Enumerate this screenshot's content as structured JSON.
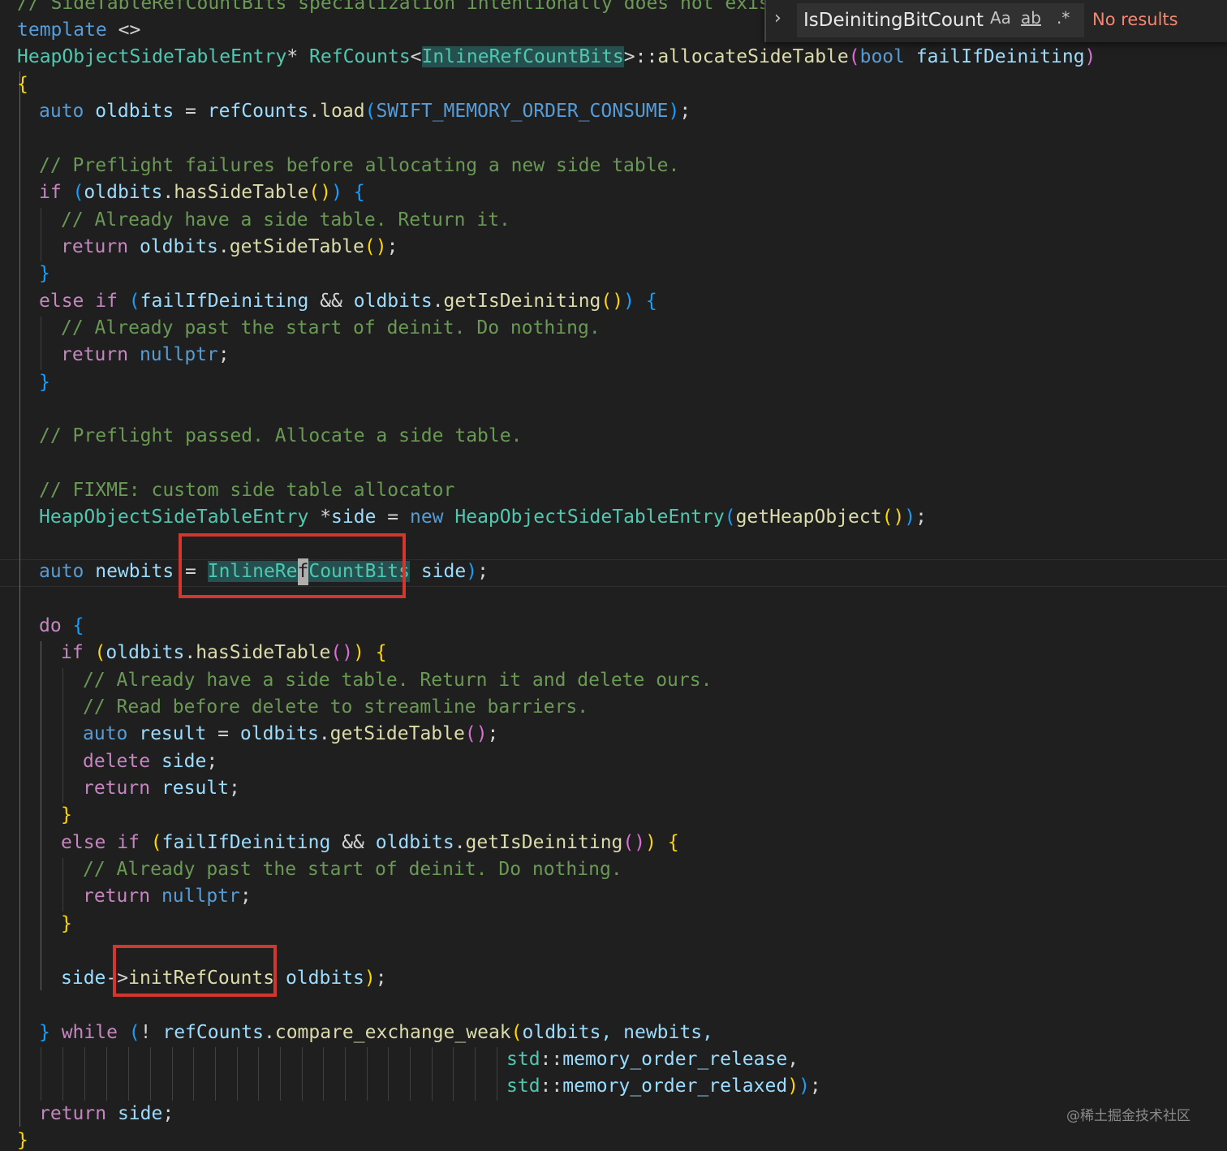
{
  "find_widget": {
    "query": "IsDeinitingBitCount",
    "match_case_label": "Aa",
    "whole_word_label": "ab",
    "regex_label": ".*",
    "status": "No results"
  },
  "code": {
    "l1": {
      "comment": "// SideTableRefCountBits specialization intentionally does not exist."
    },
    "l2": {
      "kw": "template",
      "rest": " <>"
    },
    "l3": {
      "type": "HeapObjectSideTableEntry",
      "star": "* ",
      "cls": "RefCounts",
      "lt": "<",
      "tparam": "InlineRefCountBits",
      "gt": ">::",
      "fn": "allocateSideTable",
      "lp": "(",
      "ptype": "bool",
      "pname": " failIfDeiniting",
      "rp": ")"
    },
    "l4": {
      "brace": "{"
    },
    "l5": {
      "kw": "auto",
      "v": " oldbits",
      "eq": " = ",
      "obj": "refCounts",
      "dot": ".",
      "fn": "load",
      "lp": "(",
      "const": "SWIFT_MEMORY_ORDER_CONSUME",
      "rp": ")",
      "semi": ";"
    },
    "l6": {
      "comment": "// Preflight failures before allocating a new side table."
    },
    "l7": {
      "kw": "if",
      "lp": " (",
      "obj": "oldbits",
      "dot": ".",
      "fn": "hasSideTable",
      "pp": "()",
      "rp": ")",
      "brace": " {"
    },
    "l8": {
      "comment": "// Already have a side table. Return it."
    },
    "l9": {
      "kw": "return",
      "obj": " oldbits",
      "dot": ".",
      "fn": "getSideTable",
      "pp": "()",
      "semi": ";"
    },
    "l10": {
      "brace": "}"
    },
    "l11": {
      "kw": "else if",
      "lp": " (",
      "v": "failIfDeiniting",
      "op": " && ",
      "obj": "oldbits",
      "dot": ".",
      "fn": "getIsDeiniting",
      "pp": "()",
      "rp": ")",
      "brace": " {"
    },
    "l12": {
      "comment": "// Already past the start of deinit. Do nothing."
    },
    "l13": {
      "kw": "return",
      "val": " nullptr",
      "semi": ";"
    },
    "l14": {
      "brace": "}"
    },
    "l15": {
      "comment": "// Preflight passed. Allocate a side table."
    },
    "l16": {
      "comment": "// FIXME: custom side table allocator"
    },
    "l17": {
      "type": "HeapObjectSideTableEntry",
      "op": " *",
      "v": "side",
      "eq": " = ",
      "kw": "new",
      "type2": " HeapObjectSideTableEntry",
      "lp": "(",
      "fn": "getHeapObject",
      "pp": "()",
      "rp": ")",
      "semi": ";"
    },
    "l18": {
      "kw": "auto",
      "v": " newbits",
      "eq": " = ",
      "type_a": "InlineRe",
      "cursor": "f",
      "type_b": "CountBits",
      "rest": " side",
      "rp": ")",
      "semi": ";"
    },
    "l19": {
      "kw": "do",
      "brace": " {"
    },
    "l20": {
      "kw": "if",
      "lp": " (",
      "obj": "oldbits",
      "dot": ".",
      "fn": "hasSideTable",
      "pp": "()",
      "rp": ")",
      "brace": " {"
    },
    "l21": {
      "comment": "// Already have a side table. Return it and delete ours."
    },
    "l22": {
      "comment": "// Read before delete to streamline barriers."
    },
    "l23": {
      "kw": "auto",
      "v": " result",
      "eq": " = ",
      "obj": "oldbits",
      "dot": ".",
      "fn": "getSideTable",
      "pp": "()",
      "semi": ";"
    },
    "l24": {
      "kw": "delete",
      "v": " side",
      "semi": ";"
    },
    "l25": {
      "kw": "return",
      "v": " result",
      "semi": ";"
    },
    "l26": {
      "brace": "}"
    },
    "l27": {
      "kw": "else if",
      "lp": " (",
      "v": "failIfDeiniting",
      "op": " && ",
      "obj": "oldbits",
      "dot": ".",
      "fn": "getIsDeiniting",
      "pp": "()",
      "rp": ")",
      "brace": " {"
    },
    "l28": {
      "comment": "// Already past the start of deinit. Do nothing."
    },
    "l29": {
      "kw": "return",
      "val": " nullptr",
      "semi": ";"
    },
    "l30": {
      "brace": "}"
    },
    "l31": {
      "v": "side",
      "arrow": "->",
      "fn": "initRefCounts",
      "rest": " oldbits",
      "rp": ")",
      "semi": ";"
    },
    "l32": {
      "brace": "}",
      "kw": " while",
      "lp": " (",
      "op": "! ",
      "obj": "refCounts",
      "dot": ".",
      "fn": "compare_exchange_weak",
      "lp2": "(",
      "args": "oldbits, newbits,",
      "ns": ""
    },
    "l33": {
      "ns": "std",
      "sep": "::",
      "v": "memory_order_release",
      "comma": ","
    },
    "l34": {
      "ns": "std",
      "sep": "::",
      "v": "memory_order_relaxed",
      "rp2": ")",
      "rp": ")",
      "semi": ";"
    },
    "l35": {
      "kw": "return",
      "v": " side",
      "semi": ";"
    },
    "l36": {
      "brace": "}"
    }
  },
  "watermark": "@稀土掘金技术社区"
}
